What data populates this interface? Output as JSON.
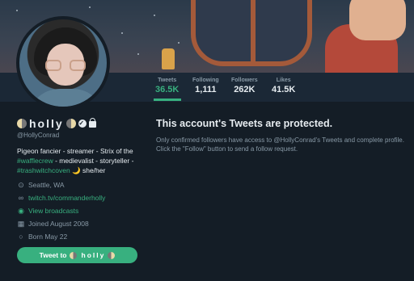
{
  "profile": {
    "display_name": "holly",
    "handle": "@HollyConrad",
    "bio_parts": [
      "Pigeon fancier - streamer - Strix of the ",
      "#wafflecrew",
      " - medievalist - storyteller - ",
      "#trashwitchcoven",
      " 🌙 she/her"
    ],
    "location": "Seattle, WA",
    "website": "twitch.tv/commanderholly",
    "broadcasts": "View broadcasts",
    "joined": "Joined August 2008",
    "born": "Born May 22",
    "tweet_to_label": "Tweet to",
    "tweet_to_name": "holly"
  },
  "stats": [
    {
      "label": "Tweets",
      "value": "36.5K"
    },
    {
      "label": "Following",
      "value": "1,111"
    },
    {
      "label": "Followers",
      "value": "262K"
    },
    {
      "label": "Likes",
      "value": "41.5K"
    }
  ],
  "protected": {
    "title": "This account's Tweets are protected.",
    "description": "Only confirmed followers have access to @HollyConrad's Tweets and complete profile. Click the \"Follow\" button to send a follow request."
  },
  "colors": {
    "accent": "#38b07f",
    "background": "#141d26",
    "muted": "#8899a6"
  }
}
